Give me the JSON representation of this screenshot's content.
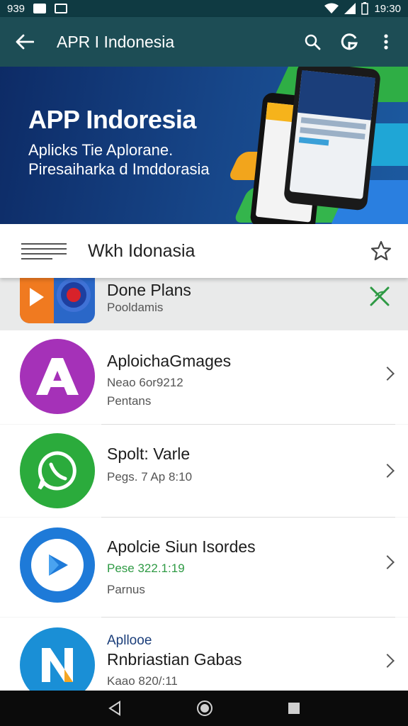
{
  "status": {
    "time_left": "939",
    "time_right": "19:30"
  },
  "app_bar": {
    "title": "APR I Indonesia"
  },
  "banner": {
    "headline": "APP Indoresia",
    "line1": "Aplicks Tie Aplorane.",
    "line2": "Piresaiharka d Imddorasia"
  },
  "search": {
    "label": "Wkh Idonasia"
  },
  "apps": [
    {
      "name": "Done Plans",
      "meta1": "Pooldamis",
      "meta2": "",
      "highlight": true
    },
    {
      "name": "AploichaGmages",
      "meta1": "Neao 6or9212",
      "meta2": "Pentans"
    },
    {
      "name": "Spolt: Varle",
      "meta1": "Pegs. 7 Ap 8:10",
      "meta2": ""
    },
    {
      "name": "Apolcie Siun Isordes",
      "meta1": "Pese 322.1:19",
      "meta2": "Parnus"
    },
    {
      "name": "Rnbriastian Gabas",
      "meta1": "Kaao 820/:11",
      "meta2": "",
      "tag": "Apllooe"
    }
  ],
  "colors": {
    "status_bar": "#0f3a42",
    "app_bar": "#1d4d55",
    "accent_green": "#2e9a44",
    "purple_icon": "#a531b8",
    "green_icon": "#2bab3c",
    "blue_icon": "#1e7ad8"
  }
}
